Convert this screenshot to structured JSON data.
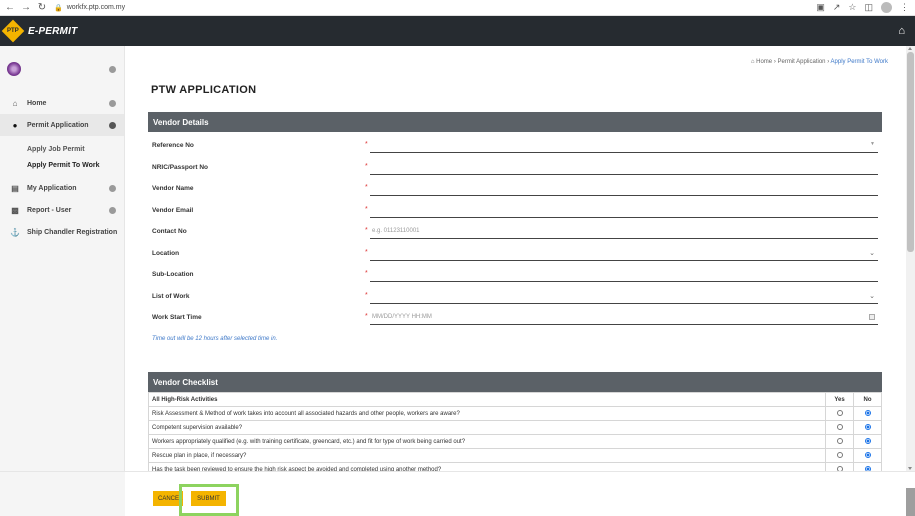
{
  "browser": {
    "url": "workfx.ptp.com.my"
  },
  "app": {
    "title": "E-PERMIT",
    "logo_icon": "ptp-logo-icon",
    "home_icon": "home-icon",
    "accent_color": "#f4b400",
    "header_color": "#262b30"
  },
  "sidebar": {
    "items": [
      {
        "label": "Home",
        "icon": "home-icon"
      },
      {
        "label": "Permit Application",
        "icon": "circle-icon",
        "active": true
      },
      {
        "label": "My Application",
        "icon": "document-icon"
      },
      {
        "label": "Report - User",
        "icon": "chart-icon"
      },
      {
        "label": "Ship Chandler Registration",
        "icon": "ship-icon"
      }
    ],
    "sub_items": [
      {
        "label": "Apply Job Permit"
      },
      {
        "label": "Apply Permit To Work",
        "current": true
      }
    ]
  },
  "breadcrumb": {
    "home": "Home",
    "level1": "Permit Application",
    "current": "Apply Permit To Work"
  },
  "page": {
    "title": "PTW APPLICATION"
  },
  "vendor_details": {
    "heading": "Vendor Details",
    "fields": [
      {
        "label": "Reference No",
        "value": "",
        "type": "select-search"
      },
      {
        "label": "NRIC/Passport No",
        "value": ""
      },
      {
        "label": "Vendor Name",
        "value": ""
      },
      {
        "label": "Vendor Email",
        "value": ""
      },
      {
        "label": "Contact No",
        "placeholder": "e.g. 01123110001"
      },
      {
        "label": "Location",
        "value": "",
        "type": "select"
      },
      {
        "label": "Sub-Location",
        "value": ""
      },
      {
        "label": "List of Work",
        "value": "",
        "type": "select"
      },
      {
        "label": "Work Start Time",
        "placeholder": "MM/DD/YYYY HH:MM",
        "type": "datetime"
      }
    ],
    "required_mark": "*",
    "note": "Time out will be 12 hours after selected time in."
  },
  "vendor_checklist": {
    "heading": "Vendor Checklist",
    "columns": [
      "All High-Risk Activities",
      "Yes",
      "No"
    ],
    "rows": [
      {
        "text": "Risk Assessment & Method of work takes into account all associated hazards and other people, workers are aware?",
        "answer": "No"
      },
      {
        "text": "Competent supervision available?",
        "answer": "No"
      },
      {
        "text": "Workers appropriately qualified (e.g. with training certificate, greencard, etc.) and fit for type of work being carried out?",
        "answer": "No"
      },
      {
        "text": "Rescue plan in place, if necessary?",
        "answer": "No"
      },
      {
        "text": "Has the task been reviewed to ensure the high risk aspect be avoided and completed using another method?",
        "answer": "No"
      }
    ]
  },
  "actions": {
    "cancel_label": "CANCEL",
    "submit_label": "SUBMIT"
  }
}
